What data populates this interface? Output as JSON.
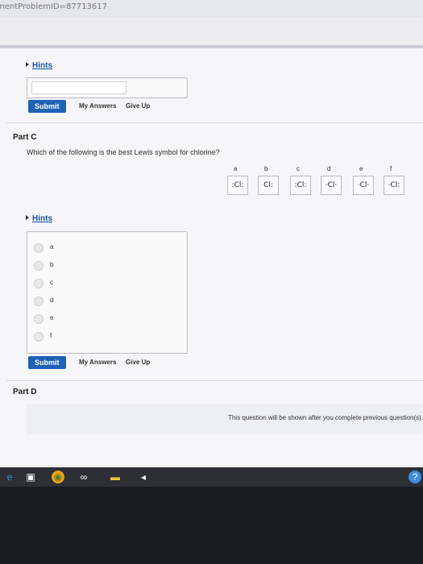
{
  "browser": {
    "url_fragment": "mentProblemID=87713617"
  },
  "part_b": {
    "hints_label": "Hints",
    "submit_label": "Submit",
    "my_answers_label": "My Answers",
    "give_up_label": "Give Up"
  },
  "part_c": {
    "title": "Part C",
    "question": "Which of the following is the best Lewis symbol for chlorine?",
    "choices": [
      {
        "letter": "a",
        "symbol": ":Cl:"
      },
      {
        "letter": "b",
        "symbol": "Cl:"
      },
      {
        "letter": "c",
        "symbol": ":Cl:"
      },
      {
        "letter": "d",
        "symbol": "·Cl·"
      },
      {
        "letter": "e",
        "symbol": "·Cl·"
      },
      {
        "letter": "f",
        "symbol": "·Cl:"
      }
    ],
    "hints_label": "Hints",
    "radio_options": [
      "a",
      "b",
      "c",
      "d",
      "e",
      "f"
    ],
    "submit_label": "Submit",
    "my_answers_label": "My Answers",
    "give_up_label": "Give Up"
  },
  "part_d": {
    "title": "Part D",
    "message": "This question will be shown after you complete previous question(s)."
  }
}
